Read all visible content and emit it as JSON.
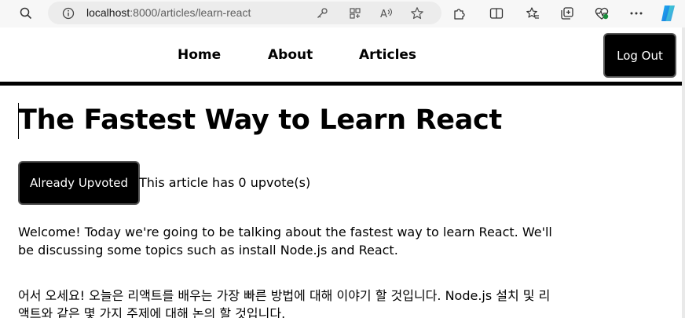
{
  "browser": {
    "url_host": "localhost",
    "url_rest": ":8000/articles/learn-react",
    "icons": [
      "search-icon",
      "info-icon",
      "key-icon",
      "app-grid-icon",
      "read-aloud-icon",
      "star-icon",
      "extensions-icon",
      "split-screen-icon",
      "favorites-icon",
      "collections-icon",
      "health-icon",
      "more-icon",
      "copilot-icon"
    ]
  },
  "nav": {
    "links": [
      "Home",
      "About",
      "Articles"
    ],
    "logout_label": "Log Out"
  },
  "article": {
    "title": "The Fastest Way to Learn React",
    "upvote_button_label": "Already Upvoted",
    "upvote_text": "This article has 0 upvote(s)",
    "paragraphs": [
      "Welcome! Today we're going to be talking about the fastest way to learn React. We'll be discussing some topics such as install Node.js and React.",
      "어서 오세요! 오늘은 리액트를 배우는 가장 빠른 방법에 대해 이야기 할 것입니다. Node.js 설치 및 리액트와 같은 몇 가지 주제에 대해 논의 할 것입니다."
    ]
  },
  "colors": {
    "button_bg": "#000000",
    "button_text": "#ffffff",
    "chrome_bg": "#f7f7f7"
  }
}
